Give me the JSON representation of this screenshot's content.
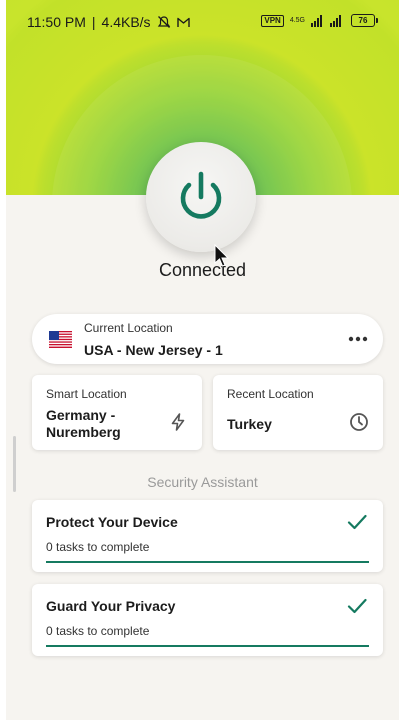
{
  "status_bar": {
    "time": "11:50 PM",
    "speed": "4.4KB/s",
    "vpn_badge": "VPN",
    "network_type": "4.5G",
    "battery_level": "76",
    "icons": [
      "mute-icon",
      "gmail-icon",
      "signal-icon",
      "battery-icon"
    ]
  },
  "connection": {
    "status": "Connected",
    "power_icon": "power-icon"
  },
  "current_location": {
    "label": "Current Location",
    "value": "USA - New Jersey - 1",
    "flag_icon": "us-flag-icon",
    "more_icon": "more-horizontal-icon"
  },
  "smart_location": {
    "label": "Smart Location",
    "value_line1": "Germany -",
    "value_line2": "Nuremberg",
    "icon": "lightning-icon"
  },
  "recent_location": {
    "label": "Recent Location",
    "value": "Turkey",
    "icon": "clock-icon"
  },
  "security_assistant": {
    "title": "Security Assistant",
    "tasks": [
      {
        "title": "Protect Your Device",
        "subtitle": "0 tasks to complete",
        "progress": 1.0
      },
      {
        "title": "Guard Your Privacy",
        "subtitle": "0 tasks to complete",
        "progress": 1.0
      }
    ]
  },
  "colors": {
    "accent": "#157a60",
    "hero_green": "#c0e01d",
    "hero_core": "#2fa24a",
    "background": "#f6f4f0"
  }
}
